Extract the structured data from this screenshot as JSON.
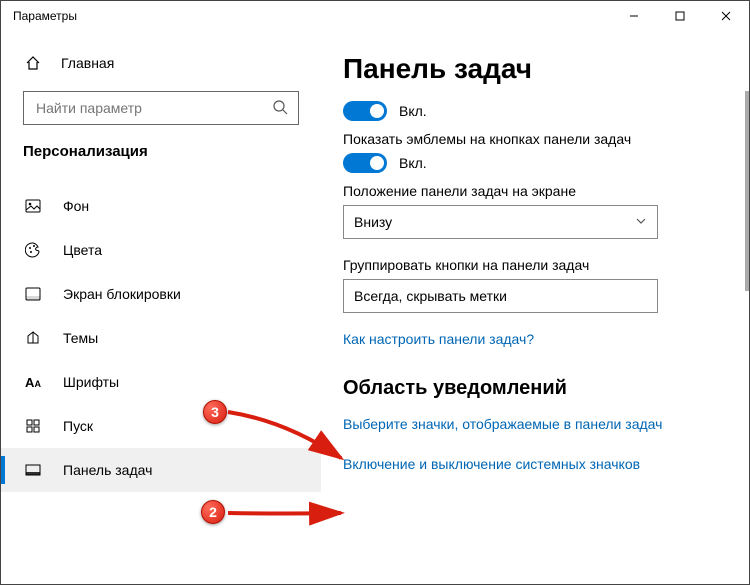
{
  "window": {
    "title": "Параметры"
  },
  "sidebar": {
    "home": "Главная",
    "search_placeholder": "Найти параметр",
    "category": "Персонализация",
    "items": [
      {
        "label": "Фон"
      },
      {
        "label": "Цвета"
      },
      {
        "label": "Экран блокировки"
      },
      {
        "label": "Темы"
      },
      {
        "label": "Шрифты"
      },
      {
        "label": "Пуск"
      },
      {
        "label": "Панель задач"
      }
    ]
  },
  "main": {
    "heading": "Панель задач",
    "toggle1_state": "Вкл.",
    "toggle2_label": "Показать эмблемы на кнопках панели задач",
    "toggle2_state": "Вкл.",
    "position_label": "Положение панели задач на экране",
    "position_value": "Внизу",
    "group_label": "Группировать кнопки на панели задач",
    "group_value": "Всегда, скрывать метки",
    "help_link": "Как настроить панели задач?",
    "section2": "Область уведомлений",
    "link1": "Выберите значки, отображаемые в панели задач",
    "link2": "Включение и выключение системных значков"
  },
  "callouts": {
    "a": "3",
    "b": "2"
  }
}
